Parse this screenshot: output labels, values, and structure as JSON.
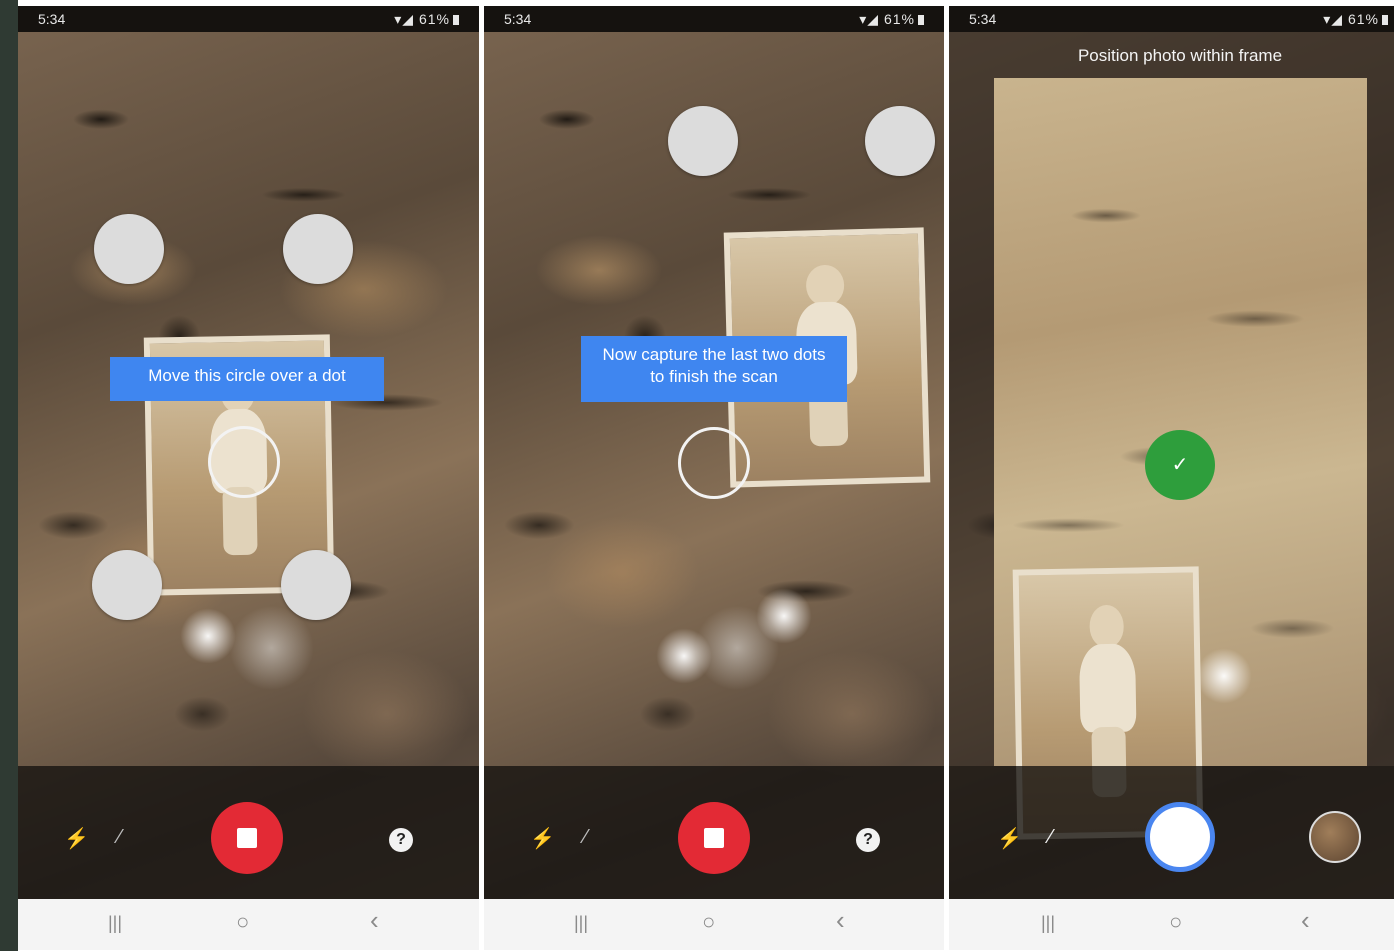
{
  "screens": [
    {
      "status": {
        "time": "5:34",
        "signal": "▾◢ 61%"
      },
      "tip": "Move this circle over a dot",
      "icons": {
        "flash": "flash-off-icon",
        "wand": "magic-wand-icon",
        "record": "stop-record-button",
        "help": "?"
      },
      "nav": {
        "recent": "|||",
        "home": "○",
        "back": "‹"
      }
    },
    {
      "status": {
        "time": "5:34",
        "signal": "▾◢ 61%"
      },
      "tip": "Now capture the last two dots to finish the scan",
      "icons": {
        "flash": "flash-off-icon",
        "wand": "magic-wand-icon",
        "record": "stop-record-button",
        "help": "?"
      },
      "nav": {
        "recent": "|||",
        "home": "○",
        "back": "‹"
      }
    },
    {
      "status": {
        "time": "5:34",
        "signal": "▾◢ 61%"
      },
      "instruction": "Position photo within frame",
      "check_symbol": "✓",
      "icons": {
        "flash": "flash-icon",
        "wand": "magic-wand-icon",
        "shutter": "shutter-button",
        "thumbnail": "gallery-thumbnail"
      },
      "nav": {
        "recent": "|||",
        "home": "○",
        "back": "‹"
      }
    }
  ],
  "colors": {
    "accent_blue": "#3f86f0",
    "record_red": "#e32a35",
    "confirm_green": "#2e9e3c"
  }
}
